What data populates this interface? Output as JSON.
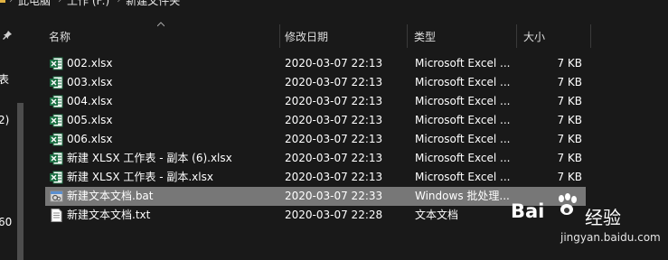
{
  "breadcrumb": {
    "items": [
      "此电脑",
      "工作 (F:)",
      "新建文件夹"
    ],
    "separator": "›"
  },
  "navpane": {
    "fragments": [
      "表",
      "2)",
      "60"
    ]
  },
  "columns": {
    "name": "名称",
    "date": "修改日期",
    "type": "类型",
    "size": "大小"
  },
  "files": [
    {
      "name": "002.xlsx",
      "date": "2020-03-07 22:13",
      "type": "Microsoft Excel ...",
      "size": "7 KB",
      "icon": "excel-icon"
    },
    {
      "name": "003.xlsx",
      "date": "2020-03-07 22:13",
      "type": "Microsoft Excel ...",
      "size": "7 KB",
      "icon": "excel-icon"
    },
    {
      "name": "004.xlsx",
      "date": "2020-03-07 22:13",
      "type": "Microsoft Excel ...",
      "size": "7 KB",
      "icon": "excel-icon"
    },
    {
      "name": "005.xlsx",
      "date": "2020-03-07 22:13",
      "type": "Microsoft Excel ...",
      "size": "7 KB",
      "icon": "excel-icon"
    },
    {
      "name": "006.xlsx",
      "date": "2020-03-07 22:13",
      "type": "Microsoft Excel ...",
      "size": "7 KB",
      "icon": "excel-icon"
    },
    {
      "name": "新建 XLSX 工作表 - 副本 (6).xlsx",
      "date": "2020-03-07 22:13",
      "type": "Microsoft Excel ...",
      "size": "7 KB",
      "icon": "excel-icon"
    },
    {
      "name": "新建 XLSX 工作表 - 副本.xlsx",
      "date": "2020-03-07 22:13",
      "type": "Microsoft Excel ...",
      "size": "7 KB",
      "icon": "excel-icon"
    },
    {
      "name": "新建文本文档.bat",
      "date": "2020-03-07 22:33",
      "type": "Windows 批处理...",
      "size": "",
      "icon": "batch-file-icon",
      "selected": true
    },
    {
      "name": "新建文本文档.txt",
      "date": "2020-03-07 22:28",
      "type": "文本文档",
      "size": "",
      "icon": "text-file-icon"
    }
  ],
  "watermark": {
    "brand": "Bai",
    "suffix": "经验",
    "url": "jingyan.baidu.com"
  },
  "colors": {
    "background": "#191919",
    "selected_row": "#777777",
    "excel_green": "#1d7044",
    "folder_yellow": "#e2b342"
  }
}
